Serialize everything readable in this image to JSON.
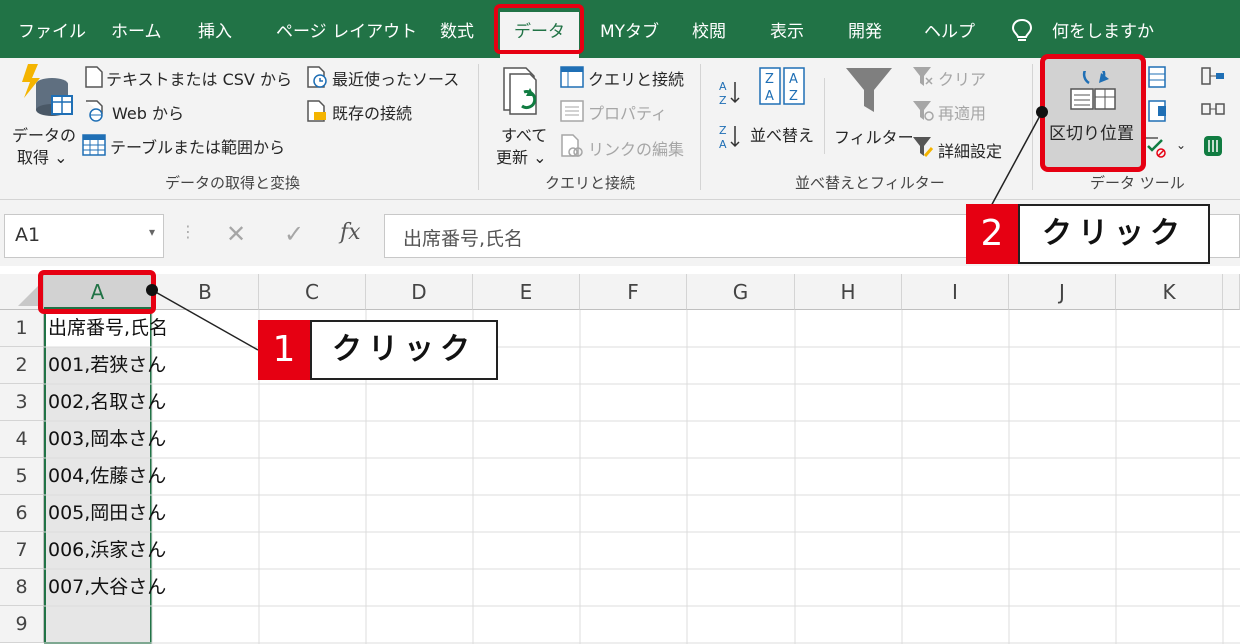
{
  "tabs": [
    "ファイル",
    "ホーム",
    "挿入",
    "ページ レイアウト",
    "数式",
    "データ",
    "MYタブ",
    "校閲",
    "表示",
    "開発",
    "ヘルプ"
  ],
  "tell_me": "何をしますか",
  "ribbon": {
    "get_data": {
      "line1": "データの",
      "line2": "取得 ⌄"
    },
    "from_text_csv": "テキストまたは CSV から",
    "from_web": "Web から",
    "from_table": "テーブルまたは範囲から",
    "recent_sources": "最近使ったソース",
    "existing_connections": "既存の接続",
    "group_get_transform": "データの取得と変換",
    "refresh_all": {
      "line1": "すべて",
      "line2": "更新 ⌄"
    },
    "queries_connections": "クエリと接続",
    "properties": "プロパティ",
    "edit_links": "リンクの編集",
    "group_queries": "クエリと接続",
    "sort": "並べ替え",
    "filter": "フィルター",
    "clear": "クリア",
    "reapply": "再適用",
    "advanced": "詳細設定",
    "group_sort_filter": "並べ替えとフィルター",
    "text_to_columns": "区切り位置",
    "group_data_tools": "データ ツール"
  },
  "formula_bar": {
    "name_box": "A1",
    "fx": "fx",
    "content": "出席番号,氏名"
  },
  "columns": [
    "A",
    "B",
    "C",
    "D",
    "E",
    "F",
    "G",
    "H",
    "I",
    "J",
    "K"
  ],
  "rows": [
    "1",
    "2",
    "3",
    "4",
    "5",
    "6",
    "7",
    "8",
    "9"
  ],
  "cells": [
    "出席番号,氏名",
    "001,若狭さん",
    "002,名取さん",
    "003,岡本さん",
    "004,佐藤さん",
    "005,岡田さん",
    "006,浜家さん",
    "007,大谷さん",
    ""
  ],
  "callouts": [
    {
      "number": "1",
      "label": "クリック"
    },
    {
      "number": "2",
      "label": "クリック"
    }
  ],
  "colors": {
    "excel_green": "#217346",
    "highlight_red": "#e60012",
    "selected_col": "#d2d2d2"
  }
}
